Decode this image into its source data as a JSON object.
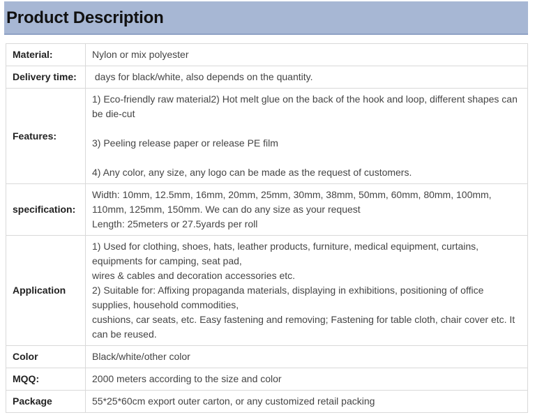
{
  "header": {
    "title": "Product Description"
  },
  "rows": [
    {
      "label": "Material:",
      "lines": [
        "Nylon or mix polyester"
      ]
    },
    {
      "label": "Delivery time:",
      "lines": [
        " days for black/white, also depends on the quantity."
      ]
    },
    {
      "label": "Features:",
      "lines": [
        "1) Eco-friendly raw material2) Hot melt glue on the back of the hook and loop, different shapes can be die-cut",
        "",
        "3) Peeling release paper or release PE film",
        "",
        "4) Any color, any size, any logo can be made as the request of customers."
      ]
    },
    {
      "label": "specification:",
      "lines": [
        "Width: 10mm, 12.5mm, 16mm, 20mm, 25mm, 30mm, 38mm, 50mm, 60mm, 80mm, 100mm, 110mm, 125mm, 150mm. We can do any size as your request",
        "Length: 25meters or 27.5yards per roll"
      ]
    },
    {
      "label": "Application",
      "lines": [
        "1) Used for clothing, shoes, hats, leather products, furniture, medical equipment, curtains, equipments for camping, seat pad,",
        "wires & cables and decoration accessories etc.",
        "2) Suitable for: Affixing propaganda materials, displaying in exhibitions, positioning of office supplies, household commodities,",
        "cushions, car seats, etc. Easy fastening and removing; Fastening for table cloth, chair cover etc. It can be reused."
      ]
    },
    {
      "label": "Color",
      "lines": [
        "Black/white/other color"
      ]
    },
    {
      "label": "MQQ:",
      "lines": [
        "2000 meters according to the size and color"
      ]
    },
    {
      "label": "Package",
      "lines": [
        "55*25*60cm export outer carton, or any customized retail packing"
      ]
    }
  ]
}
